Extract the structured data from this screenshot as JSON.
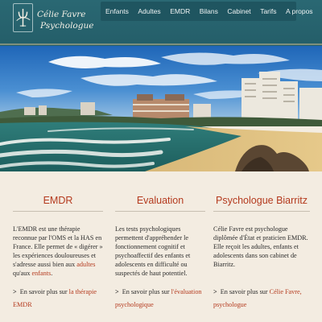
{
  "brand": {
    "line1": "Célie Favre",
    "line2": "Psychologue"
  },
  "nav": {
    "items": [
      "Enfants",
      "Adultes",
      "EMDR",
      "Bilans",
      "Cabinet",
      "Tarifs",
      "A propos"
    ]
  },
  "hero": {
    "description": "Biarritz beach photo"
  },
  "columns": [
    {
      "title": "EMDR",
      "text_before": "L'EMDR est une thérapie reconnue par l'OMS et la HAS en France. Elle permet de « digérer » les expériences douloureuses et s'adresse aussi bien aux ",
      "link1": "adultes",
      "text_mid": " qu'aux ",
      "link2": "enfants",
      "text_after": ".",
      "more_prefix": "En savoir plus sur",
      "more_link": "la thérapie EMDR"
    },
    {
      "title": "Evaluation",
      "text": "Les tests psychologiques permettent d'appréhender le fonctionnement cognitif et psychoaffectif des enfants et adolescents en difficulté ou suspectés de haut potentiel.",
      "more_prefix": "En savoir plus sur",
      "more_link": "l'évaluation psychologique"
    },
    {
      "title": "Psychologue Biarritz",
      "text": "Célie Favre est psychologue diplômée d'État et praticien EMDR. Elle reçoit les adultes, enfants et adolescents dans son cabinet de Biarritz.",
      "more_prefix": "En savoir plus sur",
      "more_link": "Célie Favre, psychologue"
    }
  ],
  "colors": {
    "header": "#2a6873",
    "nav": "#1f5560",
    "accent": "#b43a1e",
    "background": "#f3ece1"
  }
}
